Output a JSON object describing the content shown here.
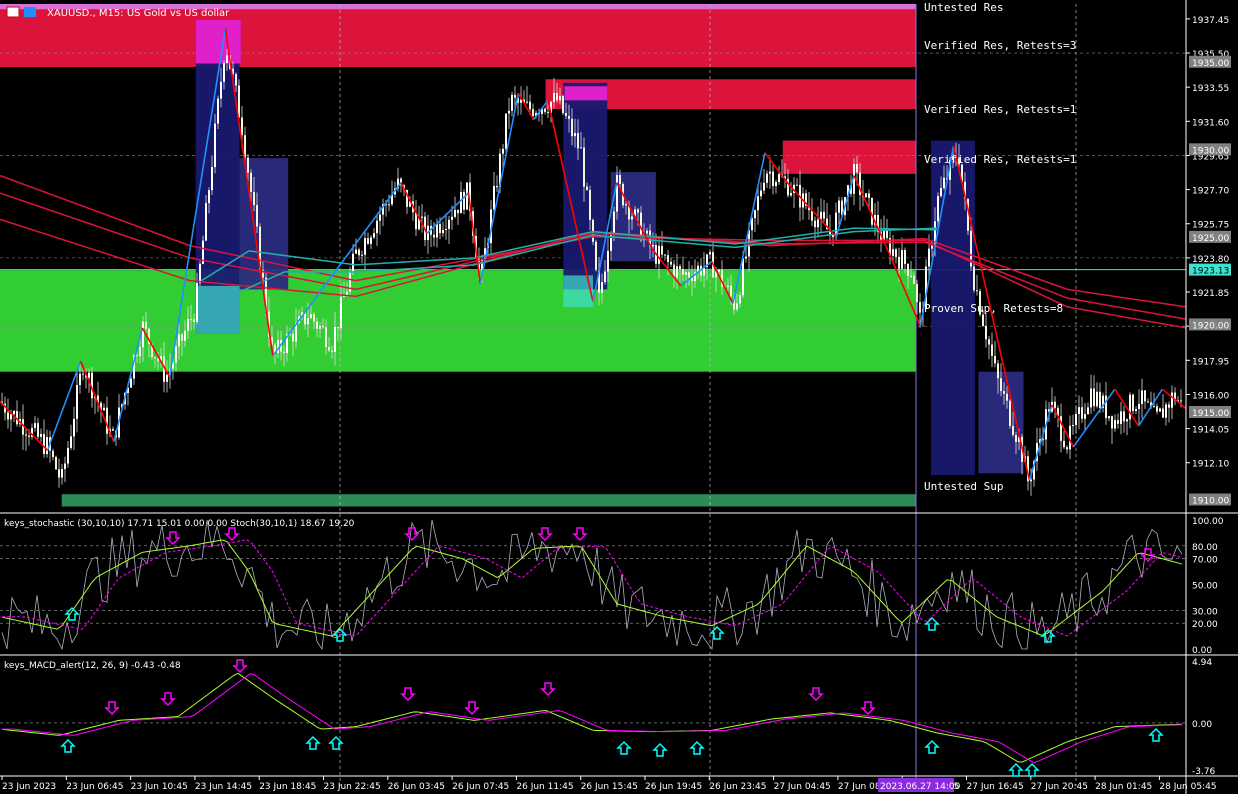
{
  "chart_data": {
    "type": "candlestick",
    "symbol_caption": "XAUUSD., M15:  US Gold vs US dollar",
    "timezone_axis_labels": [
      "23 Jun 2023",
      "23 Jun 06:45",
      "23 Jun 10:45",
      "23 Jun 14:45",
      "23 Jun 18:45",
      "23 Jun 22:45",
      "26 Jun 03:45",
      "26 Jun 07:45",
      "26 Jun 11:45",
      "26 Jun 15:45",
      "26 Jun 19:45",
      "26 Jun 23:45",
      "27 Jun 04:45",
      "27 Jun 08:45",
      "27 Jun 12:45",
      "27 Jun 16:45",
      "27 Jun 20:45",
      "28 Jun 01:45",
      "28 Jun 05:45"
    ],
    "crosshair_time_label": "2023.06.27 14:00",
    "price_axis": {
      "ylim": [
        1909.4,
        1938.3
      ],
      "tick_labels": [
        "1937.45",
        "1935.50",
        "1933.55",
        "1931.60",
        "1929.65",
        "1927.70",
        "1925.75",
        "1923.80",
        "1921.85",
        "1919.90",
        "1917.95",
        "1916.00",
        "1914.05",
        "1912.10"
      ],
      "tick_values": [
        1937.45,
        1935.5,
        1933.55,
        1931.6,
        1929.65,
        1927.7,
        1925.75,
        1923.8,
        1921.85,
        1919.9,
        1917.95,
        1916.0,
        1914.05,
        1912.1
      ],
      "highlight_labels": [
        {
          "text": "1935.00",
          "value": 1935.0,
          "style": "gray"
        },
        {
          "text": "1930.00",
          "value": 1930.0,
          "style": "gray"
        },
        {
          "text": "1925.00",
          "value": 1925.0,
          "style": "gray"
        },
        {
          "text": "1923.13",
          "value": 1923.13,
          "style": "cyan"
        },
        {
          "text": "1920.00",
          "value": 1920.0,
          "style": "gray"
        },
        {
          "text": "1915.00",
          "value": 1915.0,
          "style": "gray"
        },
        {
          "text": "1910.00",
          "value": 1910.0,
          "style": "gray"
        }
      ]
    },
    "zones": [
      {
        "label": "Untested Res",
        "low": 1937.6,
        "high": 1938.3,
        "color": "#da70d6",
        "x_start": 0,
        "x_end": 1
      },
      {
        "label": "Verified Res, Retests=3",
        "low": 1934.7,
        "high": 1938.0,
        "color": "#dc143c",
        "x_start": 0,
        "x_end": 1
      },
      {
        "label": "Verified Res, Retests=1",
        "low": 1932.3,
        "high": 1934.0,
        "color": "#dc143c",
        "x_start": 0.46,
        "x_end": 1
      },
      {
        "label": "Verified Res, Retests=1",
        "low": 1928.6,
        "high": 1930.5,
        "color": "#dc143c",
        "x_start": 0.66,
        "x_end": 1
      },
      {
        "label": "Proven Sup, Retests=8",
        "low": 1917.3,
        "high": 1923.1,
        "color": "#32cd32",
        "x_start": 0,
        "x_end": 1
      },
      {
        "label": "Untested Sup",
        "low": 1909.6,
        "high": 1910.3,
        "color": "#2e8b57",
        "x_start": 0.052,
        "x_end": 1
      }
    ],
    "current_price": 1923.13,
    "stochastic": {
      "caption": "keys_stochastic (30,10,10) 17.71 15.01 0.00 0.00 Stoch(30,10,1) 18.67 19.20",
      "ylim": [
        0,
        100
      ],
      "tick_labels": [
        "100.00",
        "80.00",
        "70.00",
        "50.00",
        "30.00",
        "20.00",
        "0.00"
      ],
      "tick_values": [
        100,
        80,
        70,
        50,
        30,
        20,
        0
      ]
    },
    "macd": {
      "caption": "keys_MACD_alert(12, 26, 9) -0.43 -0.48",
      "ylim": [
        -3.76,
        4.94
      ],
      "tick_labels": [
        "4.94",
        "0.00",
        "-3.76"
      ],
      "tick_values": [
        4.94,
        0,
        -3.76
      ]
    },
    "colors": {
      "bull": "#ffffff",
      "bear": "#f5f5dc",
      "zigzag_up": "#1e90ff",
      "zigzag_down": "#ff0000",
      "ma_red": "#dc143c",
      "ma_cyan": "#20b2aa",
      "arrow_down": "#ff00ff",
      "arrow_up": "#00ffff",
      "stoch_fast": "#b0b0c0",
      "stoch_main": "#adff2f",
      "stoch_signal": "#ff00ff"
    }
  }
}
